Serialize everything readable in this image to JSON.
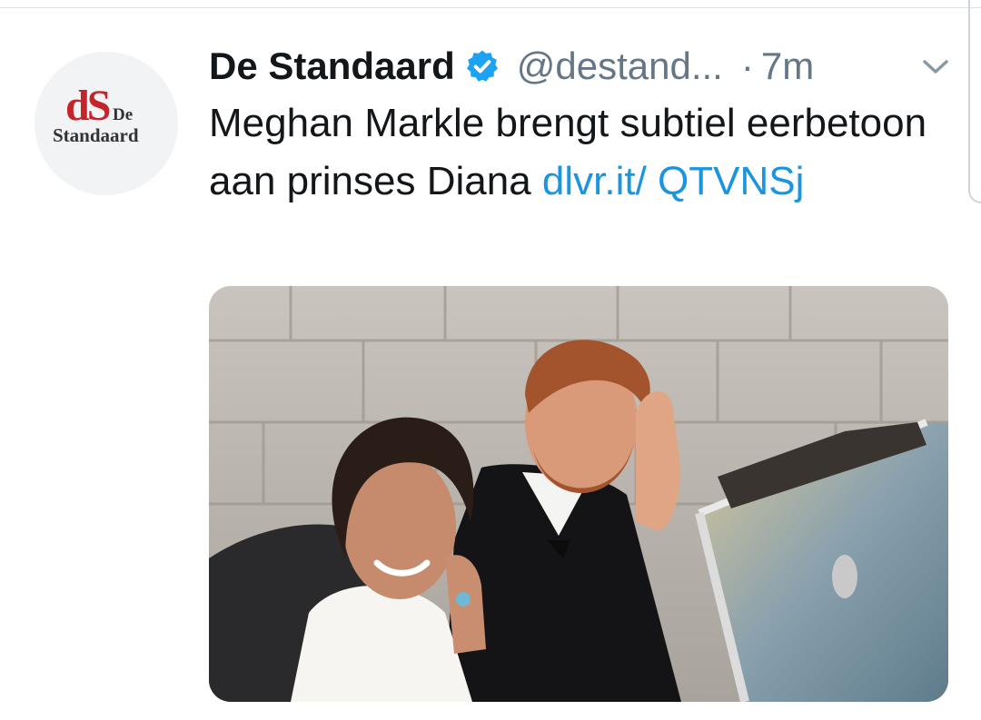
{
  "author": {
    "display_name": "De Standaard",
    "handle": "@destand...",
    "verified": true,
    "avatar": {
      "monogram": "dS",
      "word_top": "De",
      "word_bottom": "Standaard",
      "monogram_color": "#c5242b"
    }
  },
  "meta": {
    "separator": "·",
    "time": "7m"
  },
  "tweet": {
    "text": "Meghan Markle brengt subtiel eerbetoon aan prinses Diana",
    "link": "dlvr.it/ QTVNSj"
  },
  "icons": {
    "verified": "verified-badge-icon",
    "menu": "chevron-down-icon"
  },
  "colors": {
    "link": "#1b95e0",
    "secondary_text": "#657786",
    "primary_text": "#14171a",
    "verified": "#1da1f2"
  }
}
